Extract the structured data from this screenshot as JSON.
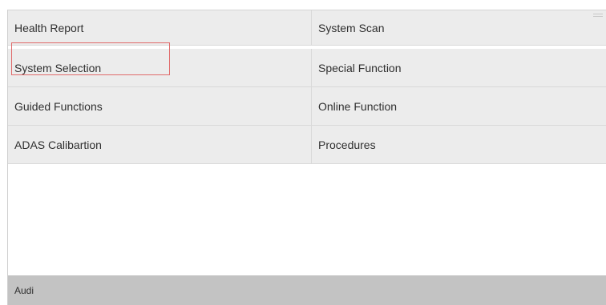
{
  "menu": {
    "items": [
      {
        "id": "health-report",
        "label": "Health Report"
      },
      {
        "id": "system-scan",
        "label": "System Scan"
      },
      {
        "id": "system-selection",
        "label": "System Selection"
      },
      {
        "id": "special-function",
        "label": "Special Function"
      },
      {
        "id": "guided-functions",
        "label": "Guided Functions"
      },
      {
        "id": "online-function",
        "label": "Online Function"
      },
      {
        "id": "adas-calibartion",
        "label": "ADAS Calibartion"
      },
      {
        "id": "procedures",
        "label": "Procedures"
      }
    ],
    "highlighted": "System Selection",
    "highlight_color": "#e06a6a"
  },
  "footer": {
    "vehicle_label": "Audi"
  },
  "colors": {
    "cell_background": "#ececec",
    "footer_background": "#c3c3c3",
    "text": "#2f2f2f"
  }
}
